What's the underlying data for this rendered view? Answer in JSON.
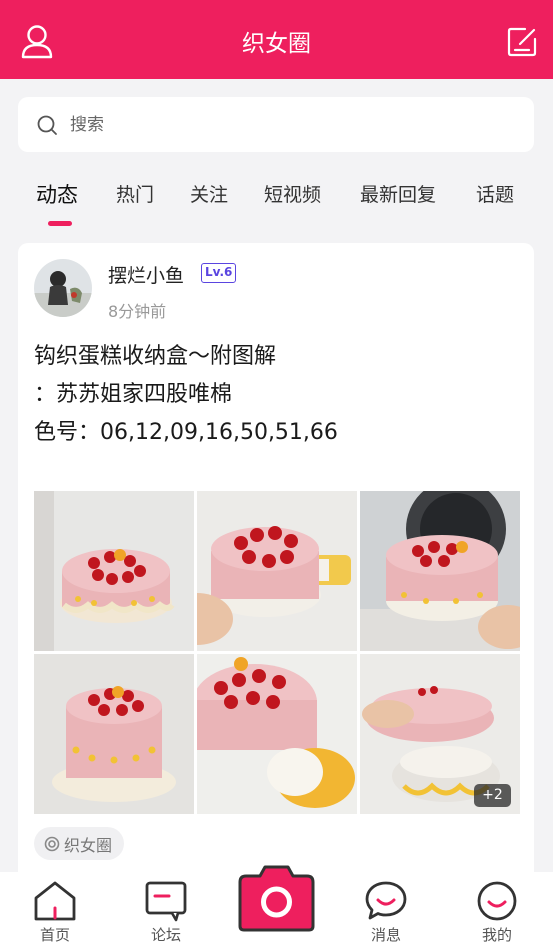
{
  "header": {
    "title": "织女圈",
    "user_icon": "user-icon",
    "edit_icon": "edit-icon",
    "accent": "#ee1f5e"
  },
  "search": {
    "placeholder": "搜索"
  },
  "tabs": [
    {
      "label": "动态",
      "active": true
    },
    {
      "label": "热门"
    },
    {
      "label": "关注"
    },
    {
      "label": "短视频"
    },
    {
      "label": "最新回复"
    },
    {
      "label": "话题"
    }
  ],
  "post": {
    "username": "摆烂小鱼",
    "level": "Lv.6",
    "time": "8分钟前",
    "text_lines": [
      "钩织蛋糕收纳盒～附图解",
      "：苏苏姐家四股唯棉",
      "色号：06,12,09,16,50,51,66"
    ],
    "more_images": "+2",
    "tag": "织女圈"
  },
  "bottom_nav": [
    {
      "label": "首页",
      "icon": "home-icon"
    },
    {
      "label": "论坛",
      "icon": "forum-icon"
    },
    {
      "label": "",
      "icon": "camera-icon"
    },
    {
      "label": "消息",
      "icon": "message-icon"
    },
    {
      "label": "我的",
      "icon": "profile-icon"
    }
  ]
}
